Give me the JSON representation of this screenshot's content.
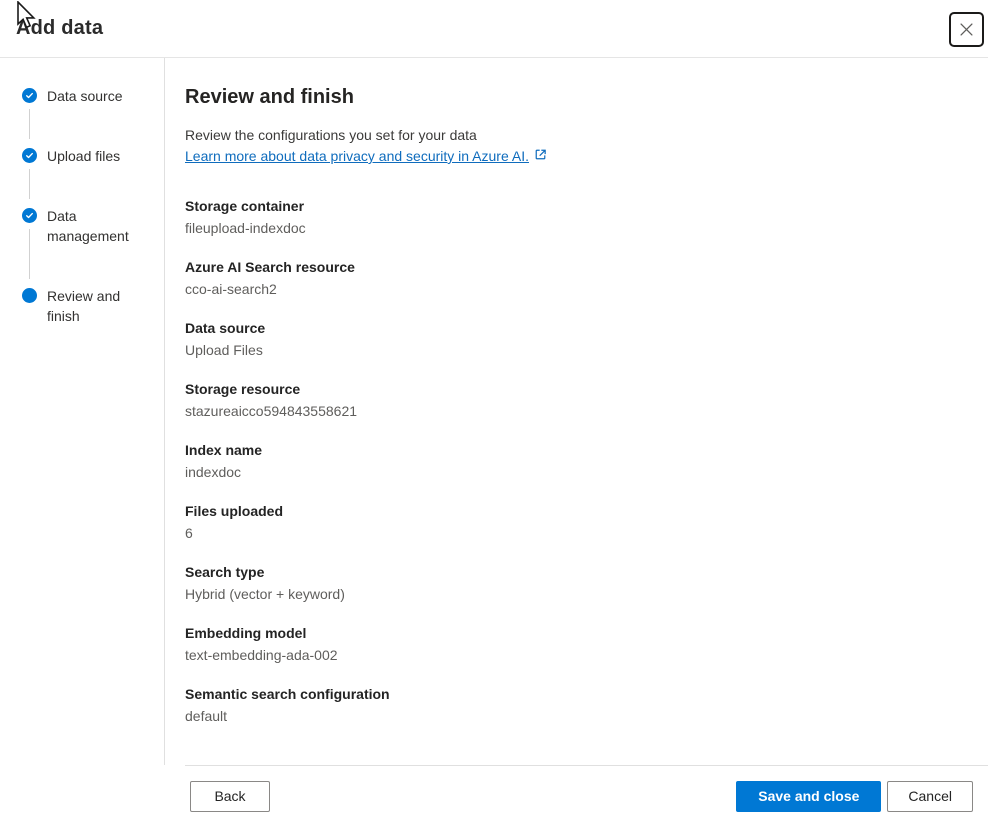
{
  "dialog": {
    "title": "Add data"
  },
  "steps": [
    {
      "label": "Data source",
      "state": "complete"
    },
    {
      "label": "Upload files",
      "state": "complete"
    },
    {
      "label": "Data management",
      "state": "complete"
    },
    {
      "label": "Review and finish",
      "state": "current"
    }
  ],
  "main": {
    "heading": "Review and finish",
    "description": "Review the configurations you set for your data",
    "link_text": "Learn more about data privacy and security in Azure AI.",
    "fields": [
      {
        "label": "Storage container",
        "value": "fileupload-indexdoc"
      },
      {
        "label": "Azure AI Search resource",
        "value": "cco-ai-search2"
      },
      {
        "label": "Data source",
        "value": "Upload Files"
      },
      {
        "label": "Storage resource",
        "value": "stazureaicco594843558621"
      },
      {
        "label": "Index name",
        "value": "indexdoc"
      },
      {
        "label": "Files uploaded",
        "value": "6"
      },
      {
        "label": "Search type",
        "value": "Hybrid (vector + keyword)"
      },
      {
        "label": "Embedding model",
        "value": "text-embedding-ada-002"
      },
      {
        "label": "Semantic search configuration",
        "value": "default"
      }
    ]
  },
  "footer": {
    "back_label": "Back",
    "save_label": "Save and close",
    "cancel_label": "Cancel"
  },
  "icons": {
    "close": "✕",
    "step_complete_check": "✓",
    "external_link": "↗",
    "mouse_cursor": "pointer-arrow"
  },
  "colors": {
    "accent": "#0078d4",
    "link": "#0f6cbd"
  }
}
